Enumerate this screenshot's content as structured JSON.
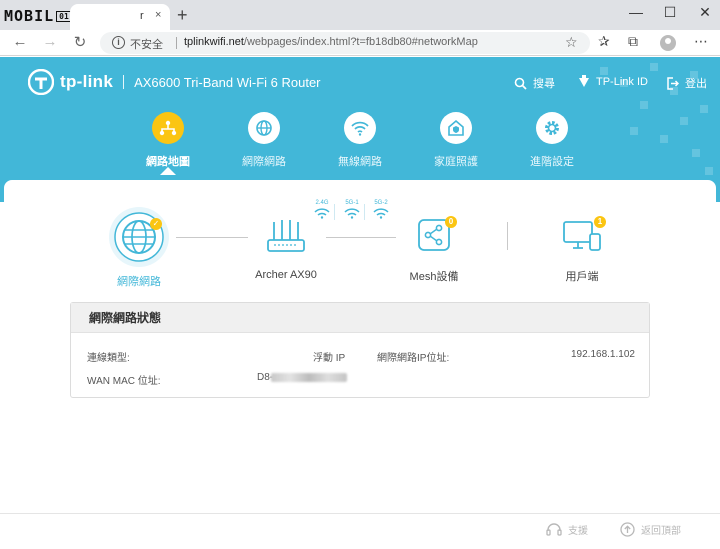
{
  "browser": {
    "watermark": "MOBILE01",
    "tab_fragment": "r",
    "tab_close": "×",
    "new_tab": "+",
    "window_controls": [
      "—",
      "☐",
      "✕"
    ],
    "security_label": "不安全",
    "url_host": "tplinkwifi.net",
    "url_path": "/webpages/index.html?t=fb18db80#networkMap"
  },
  "app": {
    "brand": "tp-link",
    "model": "AX6600 Tri-Band Wi-Fi 6 Router",
    "header_actions": [
      {
        "label": "搜尋",
        "icon": "search-icon"
      },
      {
        "label": "TP-Link ID",
        "icon": "tplink-id-icon"
      },
      {
        "label": "登出",
        "icon": "logout-icon"
      }
    ],
    "menu": [
      {
        "label": "網路地圖",
        "icon": "network-map-icon",
        "active": true
      },
      {
        "label": "網際網路",
        "icon": "globe-icon",
        "active": false
      },
      {
        "label": "無線網路",
        "icon": "wifi-icon",
        "active": false
      },
      {
        "label": "家庭照護",
        "icon": "home-care-icon",
        "active": false
      },
      {
        "label": "進階設定",
        "icon": "gear-icon",
        "active": false
      }
    ]
  },
  "topology": {
    "internet": "網際網路",
    "router": "Archer AX90",
    "bands": [
      "2.4G",
      "5G-1",
      "5G-2"
    ],
    "mesh": "Mesh設備",
    "mesh_count": "0",
    "clients": "用戶端",
    "clients_count": "1"
  },
  "status": {
    "title": "網際網路狀態",
    "connection_type_label": "連線類型:",
    "connection_type_value": "浮動 IP",
    "ip_label": "網際網路IP位址:",
    "ip_value": "192.168.1.102",
    "mac_label": "WAN MAC 位址:",
    "mac_value": "D8-"
  },
  "footer": {
    "support": "支援",
    "back_to_top": "返回頂部"
  },
  "colors": {
    "header_bg": "#42b7d8",
    "accent_yellow": "#fbc512"
  }
}
